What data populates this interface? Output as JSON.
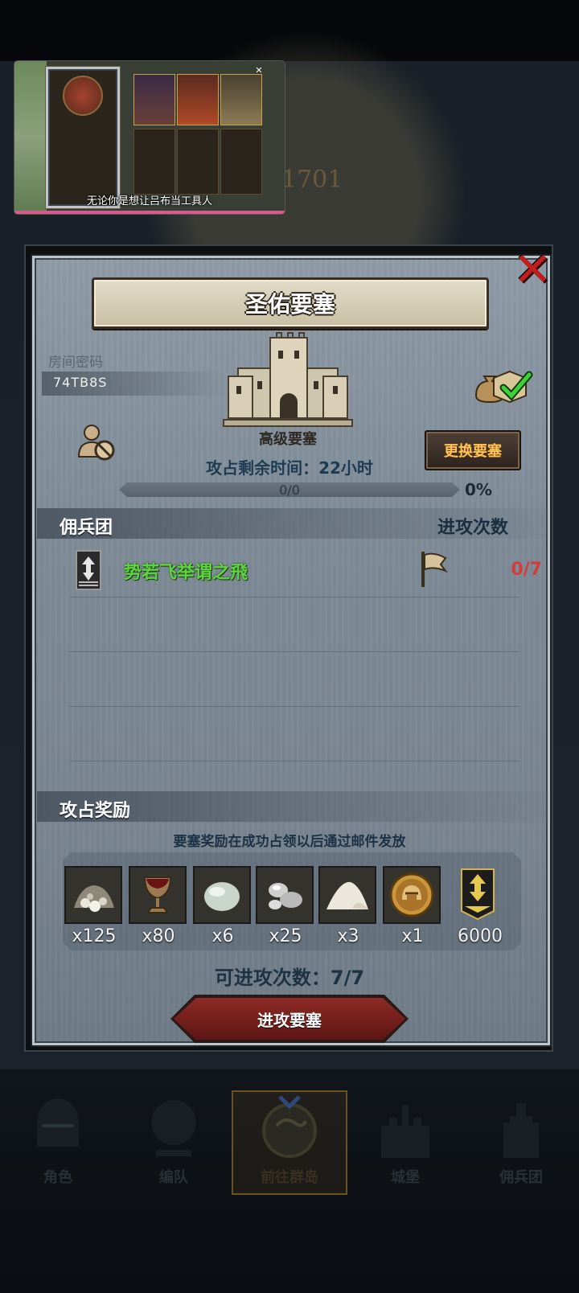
{
  "video_overlay": {
    "subtitle": "无论你是想让吕布当工具人",
    "close_glyph": "✕"
  },
  "background": {
    "map_number": "1701"
  },
  "dialog": {
    "title": "圣佑要塞",
    "close_glyph": "✕",
    "room_code_label": "房间密码",
    "room_code": "74TB8S",
    "fortress_level": "高级要塞",
    "change_button": "更换要塞",
    "time_remaining": "攻占剩余时间：22小时",
    "progress": {
      "text": "0/0",
      "percent_label": "0%",
      "fraction": 0
    },
    "mercenaries_header": "佣兵团",
    "attack_count_header": "进攻次数",
    "guild_rows": [
      {
        "name": "势若飞举谓之飛",
        "attacks": "0/7"
      }
    ],
    "rewards_header": "攻占奖励",
    "rewards_note": "要塞奖励在成功占领以后通过邮件发放",
    "rewards": [
      {
        "icon": "rock-pile-icon",
        "count": "x125"
      },
      {
        "icon": "goblet-icon",
        "count": "x80"
      },
      {
        "icon": "egg-stone-icon",
        "count": "x6"
      },
      {
        "icon": "silver-pebbles-icon",
        "count": "x25"
      },
      {
        "icon": "salt-pile-icon",
        "count": "x3"
      },
      {
        "icon": "knight-medal-icon",
        "count": "x1"
      },
      {
        "icon": "rank-badge-icon",
        "count": "6000"
      }
    ],
    "available_attacks": "可进攻次数：7/7",
    "attack_button": "进攻要塞"
  },
  "bottom_nav": [
    {
      "label": "角色",
      "icon": "knight-helmet-icon"
    },
    {
      "label": "编队",
      "icon": "squad-icon"
    },
    {
      "label": "前往群岛",
      "icon": "compass-globe-icon",
      "active": true
    },
    {
      "label": "城堡",
      "icon": "castle-icon"
    },
    {
      "label": "佣兵团",
      "icon": "mercenary-icon"
    }
  ],
  "colors": {
    "accent_gold": "#ffc35a",
    "guild_green": "#5fd441",
    "attack_red": "#d23c3c",
    "close_red": "#c41d1d"
  }
}
